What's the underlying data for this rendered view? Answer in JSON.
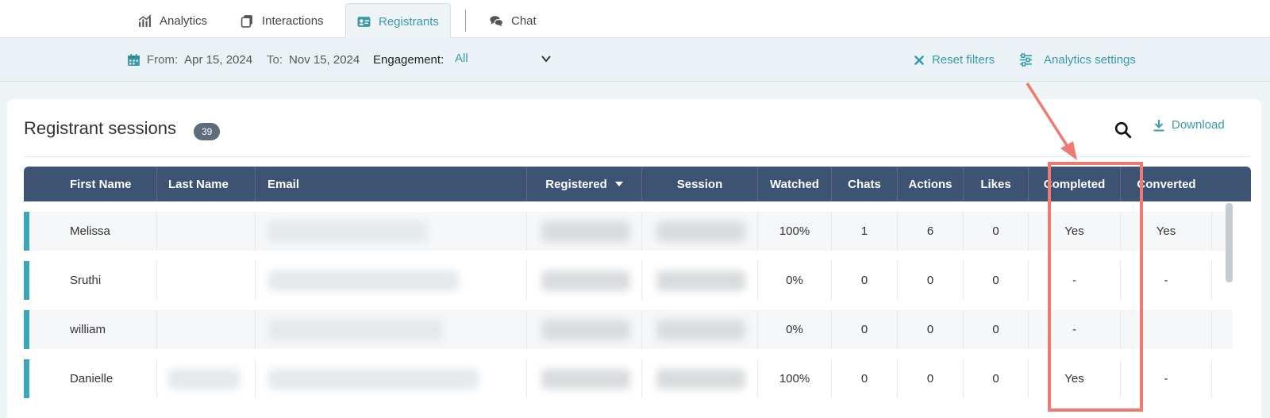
{
  "tabs": [
    {
      "label": "Analytics",
      "icon": "bar-chart-icon",
      "active": false
    },
    {
      "label": "Interactions",
      "icon": "cards-icon",
      "active": false
    },
    {
      "label": "Registrants",
      "icon": "id-card-icon",
      "active": true
    },
    {
      "label": "Chat",
      "icon": "chat-bubbles-icon",
      "active": false
    }
  ],
  "filters": {
    "from_label": "From:",
    "from_value": "Apr 15, 2024",
    "to_label": "To:",
    "to_value": "Nov 15, 2024",
    "engagement_label": "Engagement:",
    "engagement_value": "All",
    "reset_label": "Reset filters",
    "settings_label": "Analytics settings"
  },
  "card": {
    "title": "Registrant sessions",
    "count": "39",
    "download_label": "Download"
  },
  "table": {
    "columns": [
      "First Name",
      "Last Name",
      "Email",
      "Registered",
      "Session",
      "Watched",
      "Chats",
      "Actions",
      "Likes",
      "Completed",
      "Converted"
    ],
    "rows": [
      {
        "first": "Melissa",
        "watched": "100%",
        "chats": "1",
        "actions": "6",
        "likes": "0",
        "completed": "Yes",
        "converted": "Yes"
      },
      {
        "first": "Sruthi",
        "watched": "0%",
        "chats": "0",
        "actions": "0",
        "likes": "0",
        "completed": "-",
        "converted": "-"
      },
      {
        "first": "william",
        "watched": "0%",
        "chats": "0",
        "actions": "0",
        "likes": "0",
        "completed": "-",
        "converted": ""
      },
      {
        "first": "Danielle",
        "watched": "100%",
        "chats": "0",
        "actions": "0",
        "likes": "0",
        "completed": "Yes",
        "converted": "-"
      }
    ]
  },
  "colors": {
    "accent": "#3a9aaa",
    "header": "#3c5372",
    "annotation": "#ee7b73"
  }
}
